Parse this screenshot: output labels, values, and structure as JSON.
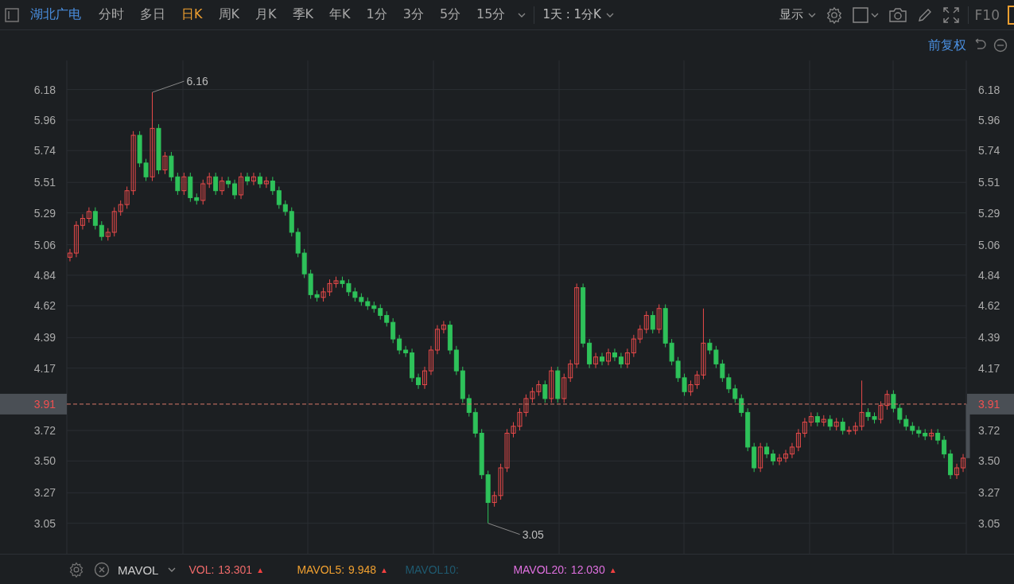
{
  "toolbar": {
    "stock_name": "湖北广电",
    "periods": [
      {
        "label": "分时",
        "selected": false
      },
      {
        "label": "多日",
        "selected": false
      },
      {
        "label": "日K",
        "selected": true
      },
      {
        "label": "周K",
        "selected": false
      },
      {
        "label": "月K",
        "selected": false
      },
      {
        "label": "季K",
        "selected": false
      },
      {
        "label": "年K",
        "selected": false
      },
      {
        "label": "1分",
        "selected": false
      },
      {
        "label": "3分",
        "selected": false
      },
      {
        "label": "5分",
        "selected": false
      },
      {
        "label": "15分",
        "selected": false
      }
    ],
    "range_select": "1天 : 1分K",
    "display_menu": "显示",
    "f10": "F10"
  },
  "adjust": {
    "label": "前复权"
  },
  "chart": {
    "price_line": {
      "right_label": "3.91"
    },
    "right_axis": [
      "6.18",
      "5.96",
      "5.74",
      "5.51",
      "5.29",
      "5.06",
      "4.84",
      "4.62",
      "4.39",
      "4.17",
      "3.72",
      "3.50",
      "3.27",
      "3.05"
    ],
    "chart_data": {
      "type": "candlestick",
      "ylim": [
        2.83,
        6.39
      ],
      "grid": true,
      "yticks": [
        6.18,
        5.96,
        5.74,
        5.51,
        5.29,
        5.06,
        4.84,
        4.62,
        4.39,
        4.17,
        3.72,
        {
          "value": 3.5,
          "label": "3.50"
        },
        3.27,
        3.05
      ],
      "ref_lines": [
        {
          "axis": "y",
          "value": 3.91,
          "label": "3.91"
        }
      ],
      "ohlc": [
        [
          4.97,
          5.03,
          4.94,
          5.0
        ],
        [
          5.0,
          5.23,
          4.97,
          5.2
        ],
        [
          5.2,
          5.28,
          5.17,
          5.25
        ],
        [
          5.25,
          5.33,
          5.22,
          5.3
        ],
        [
          5.3,
          5.33,
          5.17,
          5.2
        ],
        [
          5.2,
          5.23,
          5.09,
          5.12
        ],
        [
          5.12,
          5.18,
          5.09,
          5.15
        ],
        [
          5.15,
          5.33,
          5.12,
          5.3
        ],
        [
          5.3,
          5.38,
          5.27,
          5.35
        ],
        [
          5.35,
          5.48,
          5.32,
          5.45
        ],
        [
          5.45,
          5.88,
          5.42,
          5.85
        ],
        [
          5.85,
          5.88,
          5.62,
          5.65
        ],
        [
          5.65,
          5.68,
          5.52,
          5.55
        ],
        [
          5.55,
          6.16,
          5.52,
          5.9
        ],
        [
          5.9,
          5.93,
          5.57,
          5.6
        ],
        [
          5.6,
          5.73,
          5.57,
          5.7
        ],
        [
          5.7,
          5.73,
          5.52,
          5.55
        ],
        [
          5.55,
          5.58,
          5.42,
          5.45
        ],
        [
          5.45,
          5.58,
          5.42,
          5.55
        ],
        [
          5.55,
          5.58,
          5.37,
          5.4
        ],
        [
          5.4,
          5.43,
          5.35,
          5.38
        ],
        [
          5.38,
          5.53,
          5.35,
          5.5
        ],
        [
          5.5,
          5.58,
          5.47,
          5.55
        ],
        [
          5.55,
          5.58,
          5.42,
          5.45
        ],
        [
          5.45,
          5.55,
          5.42,
          5.52
        ],
        [
          5.52,
          5.55,
          5.47,
          5.5
        ],
        [
          5.5,
          5.53,
          5.39,
          5.42
        ],
        [
          5.42,
          5.58,
          5.39,
          5.55
        ],
        [
          5.55,
          5.58,
          5.49,
          5.52
        ],
        [
          5.52,
          5.58,
          5.49,
          5.55
        ],
        [
          5.55,
          5.58,
          5.47,
          5.5
        ],
        [
          5.5,
          5.55,
          5.47,
          5.52
        ],
        [
          5.52,
          5.55,
          5.42,
          5.45
        ],
        [
          5.45,
          5.48,
          5.32,
          5.35
        ],
        [
          5.35,
          5.38,
          5.27,
          5.3
        ],
        [
          5.3,
          5.33,
          5.12,
          5.15
        ],
        [
          5.15,
          5.18,
          4.97,
          5.0
        ],
        [
          5.0,
          5.03,
          4.82,
          4.85
        ],
        [
          4.85,
          4.88,
          4.67,
          4.7
        ],
        [
          4.7,
          4.73,
          4.65,
          4.68
        ],
        [
          4.68,
          4.75,
          4.65,
          4.72
        ],
        [
          4.72,
          4.81,
          4.69,
          4.78
        ],
        [
          4.78,
          4.83,
          4.75,
          4.8
        ],
        [
          4.8,
          4.83,
          4.75,
          4.78
        ],
        [
          4.78,
          4.81,
          4.69,
          4.72
        ],
        [
          4.72,
          4.75,
          4.65,
          4.68
        ],
        [
          4.68,
          4.71,
          4.62,
          4.65
        ],
        [
          4.65,
          4.68,
          4.59,
          4.62
        ],
        [
          4.62,
          4.65,
          4.57,
          4.6
        ],
        [
          4.6,
          4.63,
          4.52,
          4.55
        ],
        [
          4.55,
          4.58,
          4.47,
          4.5
        ],
        [
          4.5,
          4.53,
          4.35,
          4.38
        ],
        [
          4.38,
          4.41,
          4.27,
          4.3
        ],
        [
          4.3,
          4.33,
          4.25,
          4.28
        ],
        [
          4.28,
          4.31,
          4.07,
          4.1
        ],
        [
          4.1,
          4.13,
          4.02,
          4.05
        ],
        [
          4.05,
          4.18,
          4.02,
          4.15
        ],
        [
          4.15,
          4.33,
          4.12,
          4.3
        ],
        [
          4.3,
          4.48,
          4.27,
          4.45
        ],
        [
          4.45,
          4.51,
          4.42,
          4.48
        ],
        [
          4.48,
          4.51,
          4.27,
          4.3
        ],
        [
          4.3,
          4.33,
          4.12,
          4.15
        ],
        [
          4.15,
          4.18,
          3.92,
          3.95
        ],
        [
          3.95,
          3.98,
          3.82,
          3.85
        ],
        [
          3.85,
          3.88,
          3.67,
          3.7
        ],
        [
          3.7,
          3.73,
          3.37,
          3.4
        ],
        [
          3.4,
          3.43,
          3.05,
          3.2
        ],
        [
          3.2,
          3.28,
          3.17,
          3.25
        ],
        [
          3.25,
          3.48,
          3.22,
          3.45
        ],
        [
          3.45,
          3.73,
          3.42,
          3.7
        ],
        [
          3.7,
          3.78,
          3.67,
          3.75
        ],
        [
          3.75,
          3.88,
          3.72,
          3.85
        ],
        [
          3.85,
          3.98,
          3.82,
          3.95
        ],
        [
          3.95,
          4.03,
          3.92,
          4.0
        ],
        [
          4.0,
          4.08,
          3.97,
          4.05
        ],
        [
          4.05,
          4.08,
          3.92,
          3.95
        ],
        [
          3.95,
          4.18,
          3.92,
          4.15
        ],
        [
          4.15,
          4.18,
          3.92,
          3.95
        ],
        [
          3.95,
          4.13,
          3.92,
          4.1
        ],
        [
          4.1,
          4.23,
          4.07,
          4.2
        ],
        [
          4.2,
          4.78,
          4.17,
          4.75
        ],
        [
          4.75,
          4.78,
          4.32,
          4.35
        ],
        [
          4.35,
          4.38,
          4.17,
          4.2
        ],
        [
          4.2,
          4.28,
          4.17,
          4.25
        ],
        [
          4.25,
          4.28,
          4.19,
          4.22
        ],
        [
          4.22,
          4.31,
          4.19,
          4.28
        ],
        [
          4.28,
          4.31,
          4.22,
          4.25
        ],
        [
          4.25,
          4.28,
          4.17,
          4.2
        ],
        [
          4.2,
          4.31,
          4.17,
          4.28
        ],
        [
          4.28,
          4.41,
          4.25,
          4.38
        ],
        [
          4.38,
          4.48,
          4.35,
          4.45
        ],
        [
          4.45,
          4.58,
          4.42,
          4.55
        ],
        [
          4.55,
          4.58,
          4.42,
          4.45
        ],
        [
          4.45,
          4.63,
          4.42,
          4.6
        ],
        [
          4.6,
          4.63,
          4.32,
          4.35
        ],
        [
          4.35,
          4.38,
          4.19,
          4.22
        ],
        [
          4.22,
          4.25,
          4.07,
          4.1
        ],
        [
          4.1,
          4.13,
          3.97,
          4.0
        ],
        [
          4.0,
          4.08,
          3.97,
          4.05
        ],
        [
          4.05,
          4.15,
          4.02,
          4.12
        ],
        [
          4.12,
          4.6,
          4.09,
          4.35
        ],
        [
          4.35,
          4.38,
          4.27,
          4.3
        ],
        [
          4.3,
          4.33,
          4.17,
          4.2
        ],
        [
          4.2,
          4.23,
          4.07,
          4.1
        ],
        [
          4.1,
          4.13,
          3.99,
          4.02
        ],
        [
          4.02,
          4.05,
          3.92,
          3.95
        ],
        [
          3.95,
          3.98,
          3.82,
          3.85
        ],
        [
          3.85,
          3.88,
          3.57,
          3.6
        ],
        [
          3.6,
          3.63,
          3.42,
          3.45
        ],
        [
          3.45,
          3.63,
          3.42,
          3.6
        ],
        [
          3.6,
          3.63,
          3.52,
          3.55
        ],
        [
          3.55,
          3.58,
          3.47,
          3.5
        ],
        [
          3.5,
          3.55,
          3.47,
          3.52
        ],
        [
          3.52,
          3.58,
          3.49,
          3.55
        ],
        [
          3.55,
          3.63,
          3.52,
          3.6
        ],
        [
          3.6,
          3.73,
          3.57,
          3.7
        ],
        [
          3.7,
          3.81,
          3.67,
          3.78
        ],
        [
          3.78,
          3.85,
          3.75,
          3.82
        ],
        [
          3.82,
          3.85,
          3.75,
          3.78
        ],
        [
          3.78,
          3.83,
          3.75,
          3.8
        ],
        [
          3.8,
          3.83,
          3.72,
          3.75
        ],
        [
          3.75,
          3.81,
          3.72,
          3.78
        ],
        [
          3.78,
          3.81,
          3.69,
          3.72
        ],
        [
          3.72,
          3.75,
          3.69,
          3.72
        ],
        [
          3.72,
          3.78,
          3.69,
          3.75
        ],
        [
          3.75,
          4.08,
          3.72,
          3.85
        ],
        [
          3.85,
          3.88,
          3.79,
          3.82
        ],
        [
          3.82,
          3.85,
          3.77,
          3.8
        ],
        [
          3.8,
          3.93,
          3.77,
          3.9
        ],
        [
          3.9,
          4.01,
          3.87,
          3.98
        ],
        [
          3.98,
          4.01,
          3.85,
          3.88
        ],
        [
          3.88,
          3.91,
          3.77,
          3.8
        ],
        [
          3.8,
          3.83,
          3.72,
          3.75
        ],
        [
          3.75,
          3.78,
          3.69,
          3.72
        ],
        [
          3.72,
          3.75,
          3.67,
          3.7
        ],
        [
          3.7,
          3.73,
          3.65,
          3.68
        ],
        [
          3.68,
          3.73,
          3.65,
          3.7
        ],
        [
          3.7,
          3.73,
          3.62,
          3.65
        ],
        [
          3.65,
          3.68,
          3.52,
          3.55
        ],
        [
          3.55,
          3.58,
          3.37,
          3.4
        ],
        [
          3.4,
          3.48,
          3.37,
          3.45
        ],
        [
          3.45,
          3.55,
          3.42,
          3.52
        ]
      ],
      "annotations": [
        {
          "text": "6.16"
        },
        {
          "text": "3.05"
        }
      ]
    }
  },
  "indicator_bar": {
    "name": "MAVOL",
    "items": [
      {
        "label": "VOL:",
        "value": "13.301",
        "arrow": "▲",
        "color": "#f06a6a"
      },
      {
        "label": "MAVOL5:",
        "value": "9.948",
        "arrow": "▲",
        "color": "#f0a030"
      },
      {
        "label": "MAVOL10:",
        "color": "#1f5a70"
      },
      {
        "label": "MAVOL20:",
        "value": "12.030",
        "arrow": "▲",
        "color": "#e070e0"
      }
    ]
  }
}
